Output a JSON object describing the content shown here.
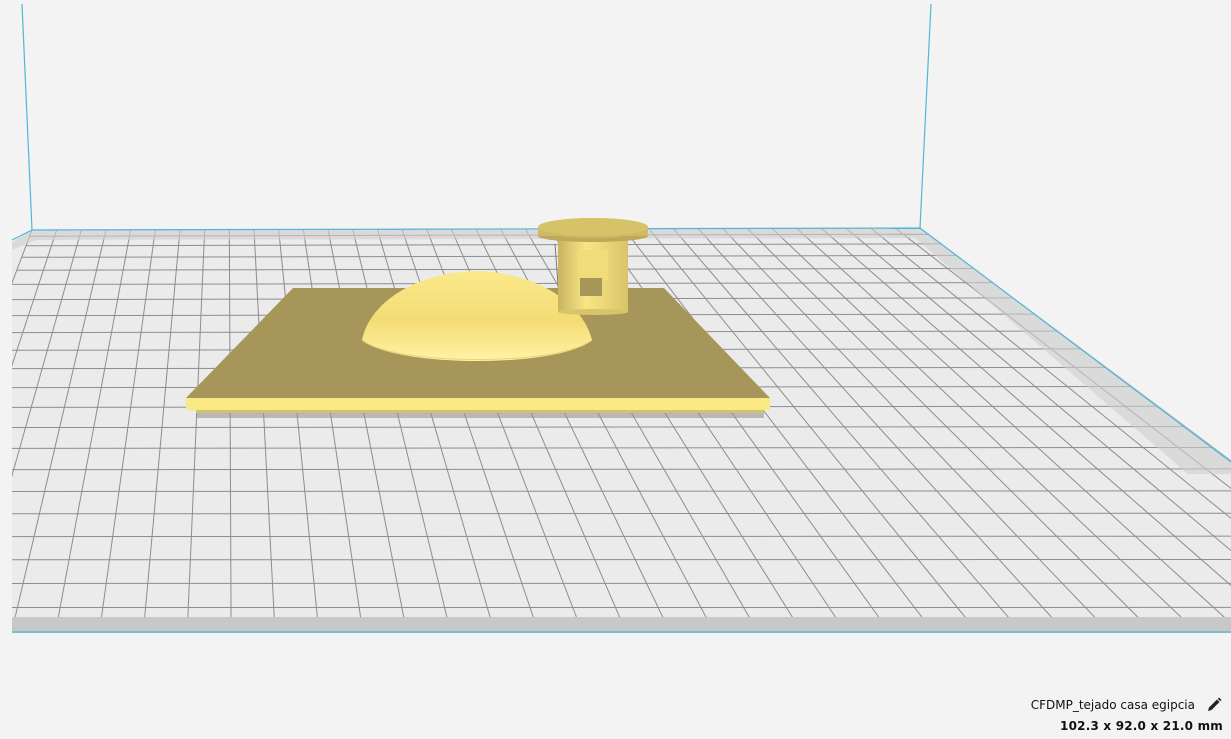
{
  "object": {
    "name": "CFDMP_tejado casa egipcia",
    "dimensions": "102.3 x 92.0 x 21.0 mm",
    "edit_icon": "pencil-icon"
  },
  "colors": {
    "background": "#f3f3f3",
    "build_volume_edge": "#4fb7d9",
    "plate_grid": "#8c8c8c",
    "plate_fill": "#ebebeb",
    "model": "#f5e27a",
    "model_shadow": "#a39356"
  }
}
